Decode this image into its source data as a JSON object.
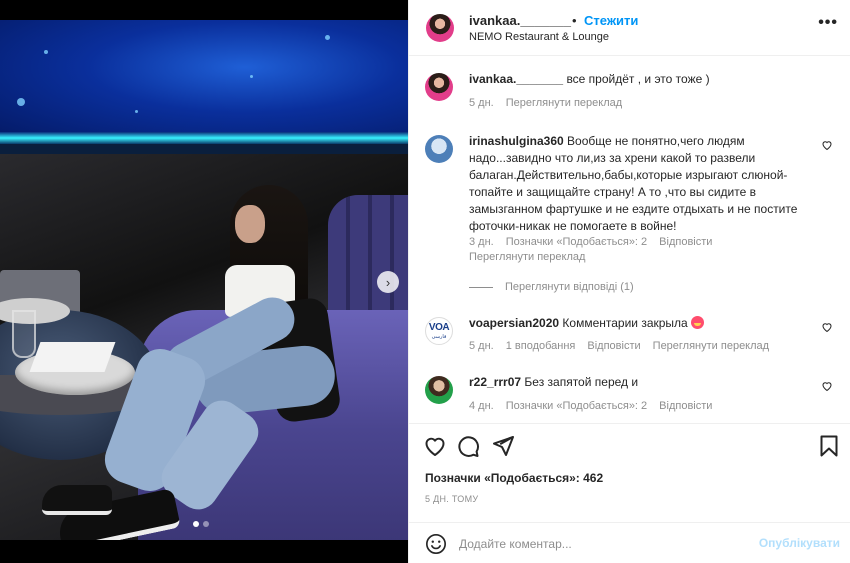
{
  "post": {
    "username": "ivankaa._______",
    "dot": "•",
    "follow_label": "Стежити",
    "location": "NEMO Restaurant & Lounge",
    "more_label": "•••",
    "next_label": "›"
  },
  "comments": [
    {
      "username": "ivankaa._______",
      "text": "все пройдёт , и это тоже )",
      "time": "5 дн.",
      "likes": "",
      "reply": "",
      "translate": "Переглянути переклад"
    },
    {
      "username": "irinashulgina360",
      "text": "Вообще не понятно,чего людям надо...завидно что ли,из за хрени какой то развели балаган.Действительно,бабы,которые изрыгают слюной-топайте и защищайте страну! А то ,что вы сидите в замызганном фартушке и не ездите отдыхать и не постите фоточки-никак не помогаете в войне!",
      "time": "3 дн.",
      "likes": "Позначки «Подобається»: 2",
      "reply": "Відповісти",
      "translate": "Переглянути переклад",
      "view_replies": "Переглянути відповіді (1)"
    },
    {
      "username": "voapersian2020",
      "text": "Комментарии закрыла",
      "time": "5 дн.",
      "likes": "1 вподобання",
      "reply": "Відповісти",
      "translate": "Переглянути переклад",
      "avatar_text": "VOA",
      "avatar_sub": "فارسی"
    },
    {
      "username": "r22_rrr07",
      "text": "Без запятой перед и",
      "time": "4 дн.",
      "likes": "Позначки «Подобається»: 2",
      "reply": "Відповісти",
      "translate": ""
    }
  ],
  "footer": {
    "likes_text": "Позначки «Подобається»: 462",
    "time_ago": "5 ДН. ТОМУ",
    "comment_placeholder": "Додайте коментар...",
    "publish_label": "Опублікувати"
  },
  "icons": {
    "like": "heart-icon",
    "comment": "comment-icon",
    "share": "share-icon",
    "save": "bookmark-icon",
    "emoji": "smile-icon",
    "more": "more-icon"
  },
  "colors": {
    "accent": "#0095f6",
    "publish_disabled": "#b2dffc",
    "muted": "#8e8e8e"
  },
  "carousel": {
    "total": 2,
    "active": 1
  }
}
